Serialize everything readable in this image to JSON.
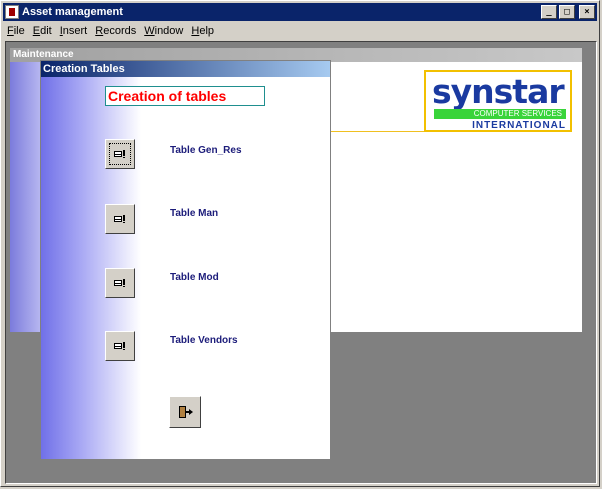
{
  "app": {
    "title": "Asset management"
  },
  "window_controls": {
    "minimize": "_",
    "maximize": "□",
    "close": "×"
  },
  "menu": [
    {
      "accel": "F",
      "rest": "ile"
    },
    {
      "accel": "E",
      "rest": "dit"
    },
    {
      "accel": "I",
      "rest": "nsert"
    },
    {
      "accel": "R",
      "rest": "ecords"
    },
    {
      "accel": "W",
      "rest": "indow"
    },
    {
      "accel": "H",
      "rest": "elp"
    }
  ],
  "maintenance": {
    "title": "Maintenance"
  },
  "logo": {
    "word": "synstar",
    "tagline": "COMPUTER SERVICES",
    "sub": "INTERNATIONAL"
  },
  "form": {
    "title": "Creation Tables",
    "heading": "Creation of tables",
    "tables": [
      {
        "label": "Table Gen_Res"
      },
      {
        "label": "Table Man"
      },
      {
        "label": "Table Mod"
      },
      {
        "label": "Table Vendors"
      }
    ]
  },
  "icons": {
    "table": "table-run-icon",
    "exit": "exit-door-icon"
  },
  "colors": {
    "title_active": "#0a246a",
    "heading_text": "#ff0000",
    "label_text": "#1c1c7a",
    "logo_blue": "#1a3aa0",
    "logo_green": "#39d43a",
    "logo_border": "#f2c000"
  }
}
